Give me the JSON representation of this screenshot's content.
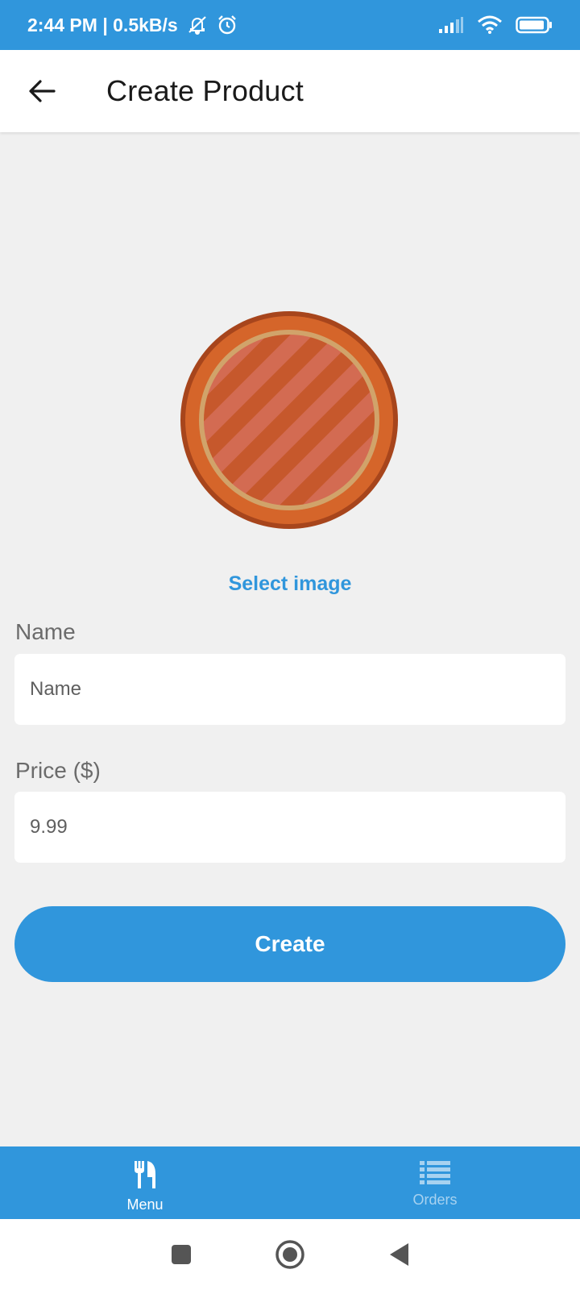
{
  "status_bar": {
    "time_speed": "2:44 PM | 0.5kB/s",
    "icons": [
      "bell-off-icon",
      "alarm-icon",
      "signal-icon",
      "wifi-icon",
      "battery-icon"
    ]
  },
  "app_bar": {
    "back_icon": "arrow-left-icon",
    "title": "Create Product"
  },
  "form": {
    "image_alt": "pizza",
    "select_image_label": "Select image",
    "name": {
      "label": "Name",
      "placeholder": "Name",
      "value": ""
    },
    "price": {
      "label": "Price ($)",
      "placeholder": "9.99",
      "value": ""
    },
    "create_label": "Create"
  },
  "tabs": [
    {
      "label": "Menu",
      "icon": "fork-knife-icon",
      "active": true
    },
    {
      "label": "Orders",
      "icon": "list-icon",
      "active": false
    }
  ],
  "nav": {
    "icons": [
      "recents-square-icon",
      "home-circle-icon",
      "back-triangle-icon"
    ]
  },
  "colors": {
    "accent": "#3096dc",
    "background": "#f0f0f0",
    "inactive_tab": "#a7d2f0"
  }
}
